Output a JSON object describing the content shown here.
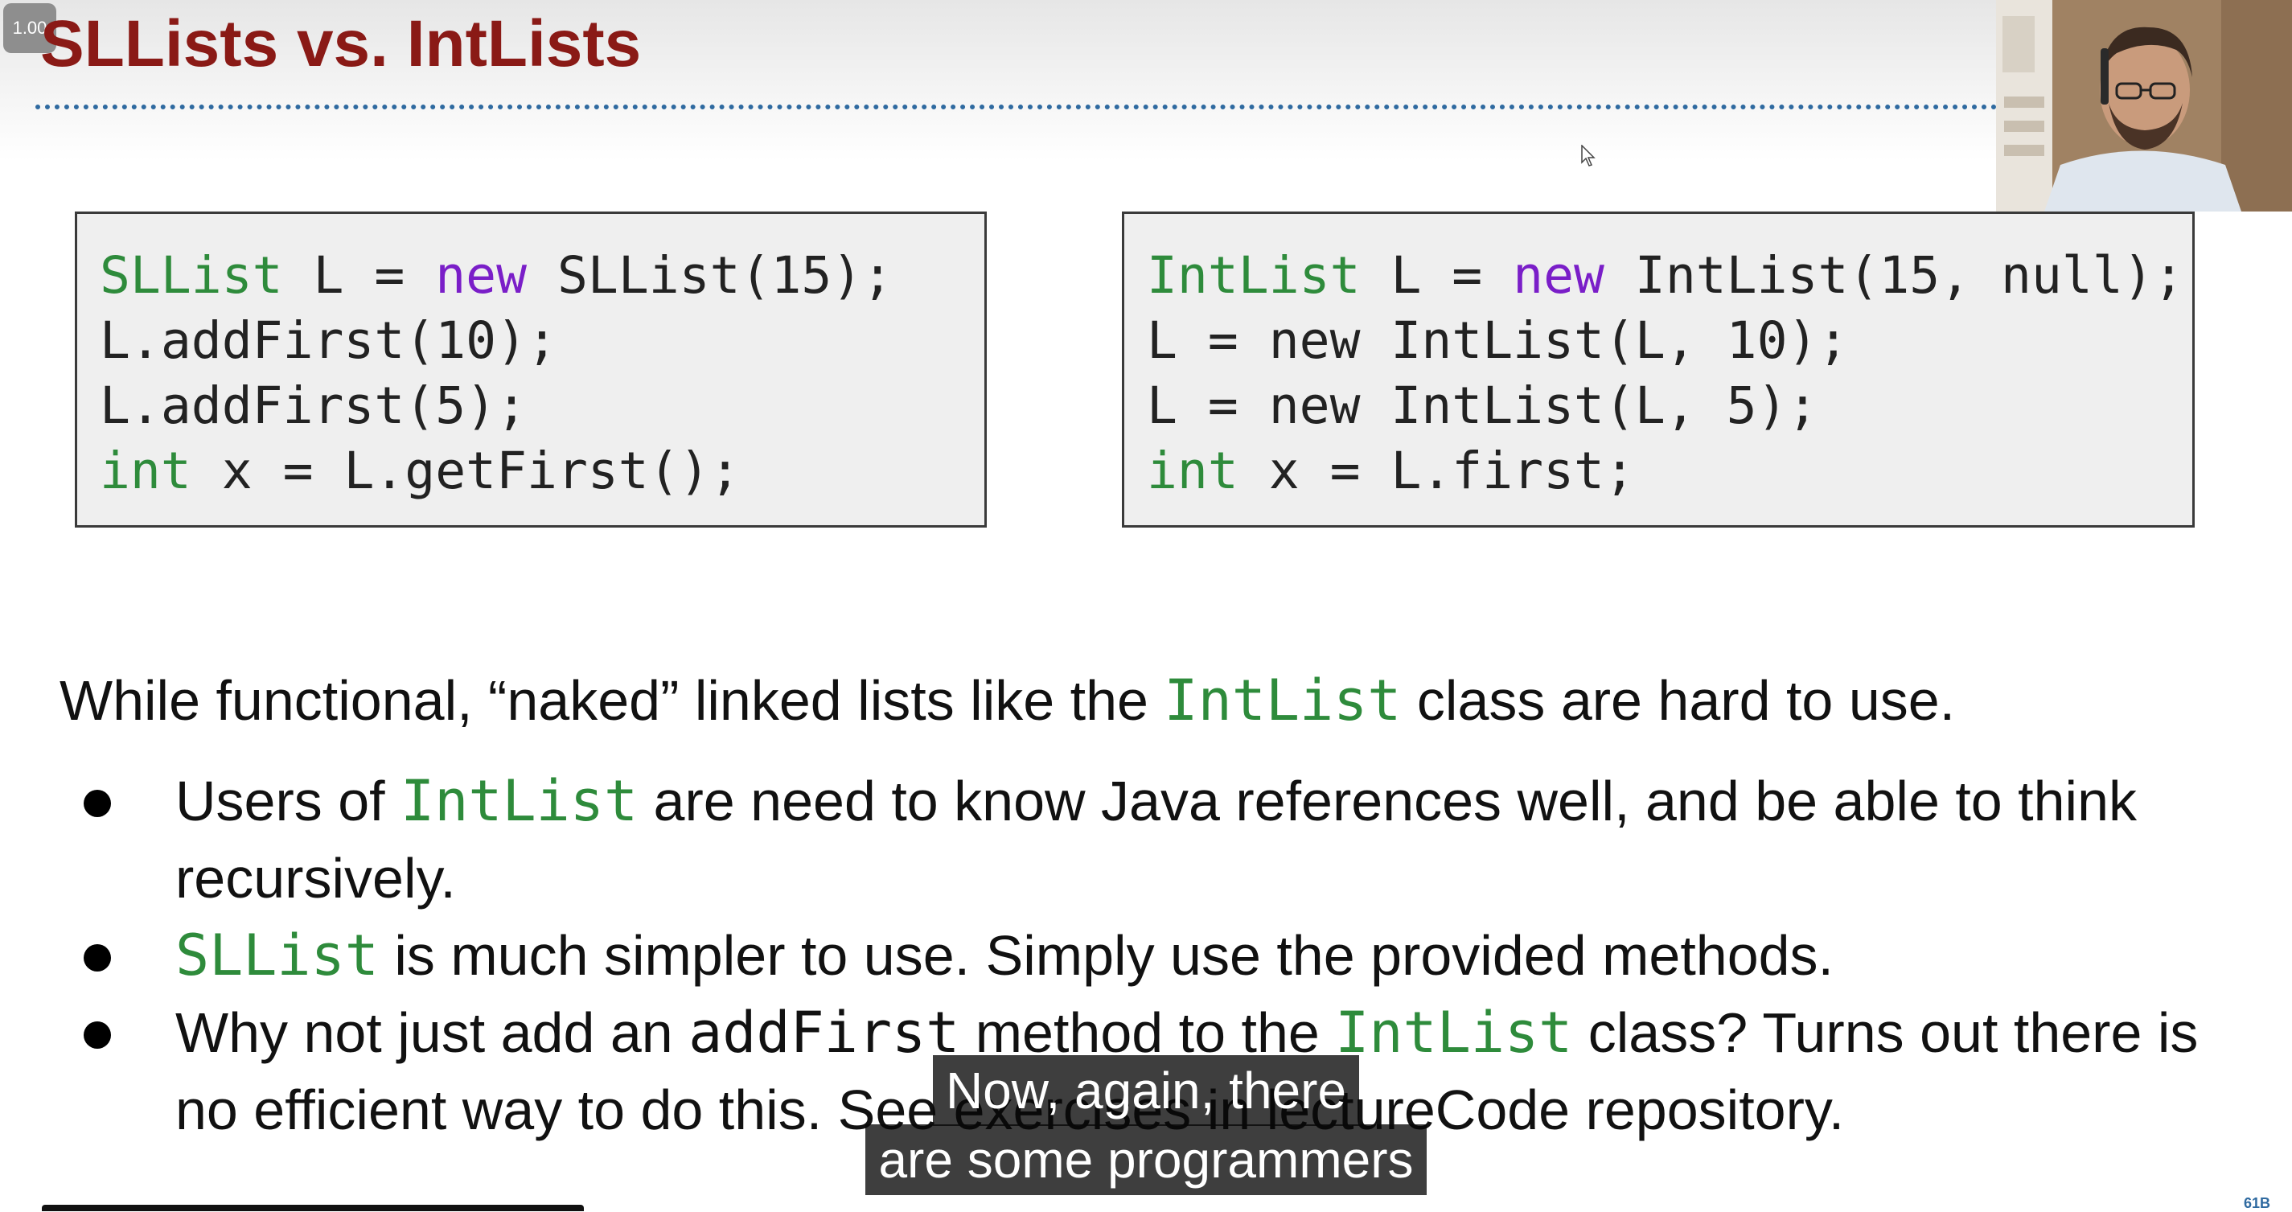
{
  "player": {
    "speed_label": "1.00"
  },
  "slide": {
    "title": "SLLists vs. IntLists",
    "left_code": [
      {
        "type_kw": "SLList",
        "a": " L = ",
        "new_kw": "new",
        "b": " SLList(15);"
      },
      {
        "type_kw": "",
        "a": "L.addFirst(10);",
        "new_kw": "",
        "b": ""
      },
      {
        "type_kw": "",
        "a": "L.addFirst(5);",
        "new_kw": "",
        "b": ""
      },
      {
        "type_kw": "int",
        "a": " x = L.getFirst();",
        "new_kw": "",
        "b": ""
      }
    ],
    "right_code": [
      {
        "type_kw": "IntList",
        "a": " L = ",
        "new_kw": "new",
        "b": " IntList(15, null);"
      },
      {
        "type_kw": "",
        "a": "L = new IntList(L, 10);",
        "new_kw": "",
        "b": ""
      },
      {
        "type_kw": "",
        "a": "L = new IntList(L, 5);",
        "new_kw": "",
        "b": ""
      },
      {
        "type_kw": "int",
        "a": " x = L.first;",
        "new_kw": "",
        "b": ""
      }
    ],
    "intro": {
      "before": "While functional, “naked” linked lists like the ",
      "code": "IntList",
      "after": " class are hard to use."
    },
    "bullets": [
      {
        "b1": "Users of ",
        "code1": "IntList",
        "b2": " are need to know Java references well, and be able to think recursively."
      },
      {
        "code1": "SLList",
        "b2": " is much simpler to use. Simply use the provided methods."
      },
      {
        "b1": "Why not just add an ",
        "code1": "addFirst",
        "b2": " method to the ",
        "code2": "IntList",
        "b3": " class? Turns out there is no efficient way to do this. See exercises in lectureCode repository."
      }
    ]
  },
  "captions": {
    "line1": "Now, again, there",
    "line2": "are some programmers"
  },
  "watermark": "61B",
  "colors": {
    "title": "#8a1a16",
    "type_keyword": "#2e8b3b",
    "new_keyword": "#7a1ec8",
    "divider": "#2f6aa0"
  }
}
